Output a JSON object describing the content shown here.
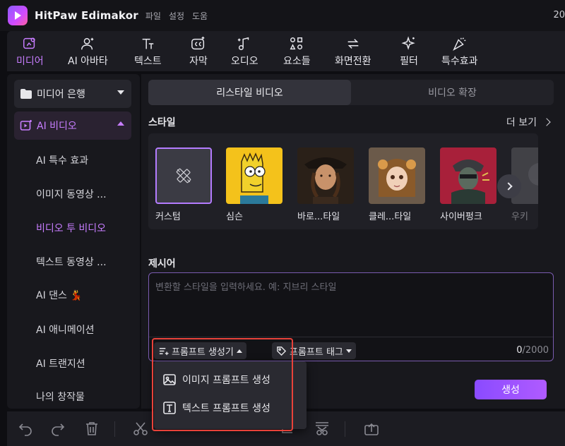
{
  "app": {
    "title": "HitPaw Edimakor",
    "menu": [
      "파일",
      "설정",
      "도움"
    ],
    "right_text": "20"
  },
  "toolbar": {
    "items": [
      {
        "label": "미디어",
        "icon": "media-icon",
        "active": true
      },
      {
        "label": "AI 아바타",
        "icon": "avatar-icon"
      },
      {
        "label": "텍스트",
        "icon": "text-icon"
      },
      {
        "label": "자막",
        "icon": "caption-icon"
      },
      {
        "label": "오디오",
        "icon": "audio-icon"
      },
      {
        "label": "요소들",
        "icon": "elements-icon"
      },
      {
        "label": "화면전환",
        "icon": "transition-icon"
      },
      {
        "label": "필터",
        "icon": "filter-icon"
      },
      {
        "label": "특수효과",
        "icon": "effects-icon"
      }
    ]
  },
  "sidebar": {
    "bank": "미디어 은행",
    "ai_video": "AI 비디오",
    "items": [
      {
        "label": "AI 특수 효과"
      },
      {
        "label": "이미지 동영상 ..."
      },
      {
        "label": "비디오 투 비디오",
        "active": true
      },
      {
        "label": "텍스트 동영상 ..."
      },
      {
        "label": "AI 댄스 💃"
      },
      {
        "label": "AI 애니메이션"
      },
      {
        "label": "AI 트랜지션"
      },
      {
        "label": "나의 창작물"
      }
    ]
  },
  "main": {
    "tabs": [
      {
        "label": "리스타일 비디오",
        "active": true
      },
      {
        "label": "비디오 확장"
      }
    ],
    "style_section": {
      "title": "스타일",
      "more": "더 보기",
      "cards": [
        {
          "name": "커스텀",
          "selected": true
        },
        {
          "name": "심슨"
        },
        {
          "name": "바로...타일"
        },
        {
          "name": "클레...타일"
        },
        {
          "name": "사이버펑크"
        },
        {
          "name": "우키"
        }
      ]
    },
    "prompt_section": {
      "title": "제시어",
      "placeholder": "변환할 스타일을 입력하세요. 예: 지브리 스타일",
      "generator_label": "프롬프트 생성기",
      "tag_label": "프롬프트 태그",
      "counter_current": "0",
      "counter_max": "/2000"
    },
    "generate_label": "생성"
  },
  "dropdown": {
    "items": [
      {
        "label": "이미지 프롬프트  생성",
        "icon": "image-icon"
      },
      {
        "label": "텍스트 프롬프트 생성",
        "icon": "text-box-icon"
      }
    ]
  },
  "colors": {
    "accent": "#c77dff",
    "generate": "#9d52ff",
    "highlight": "#e8423a"
  }
}
